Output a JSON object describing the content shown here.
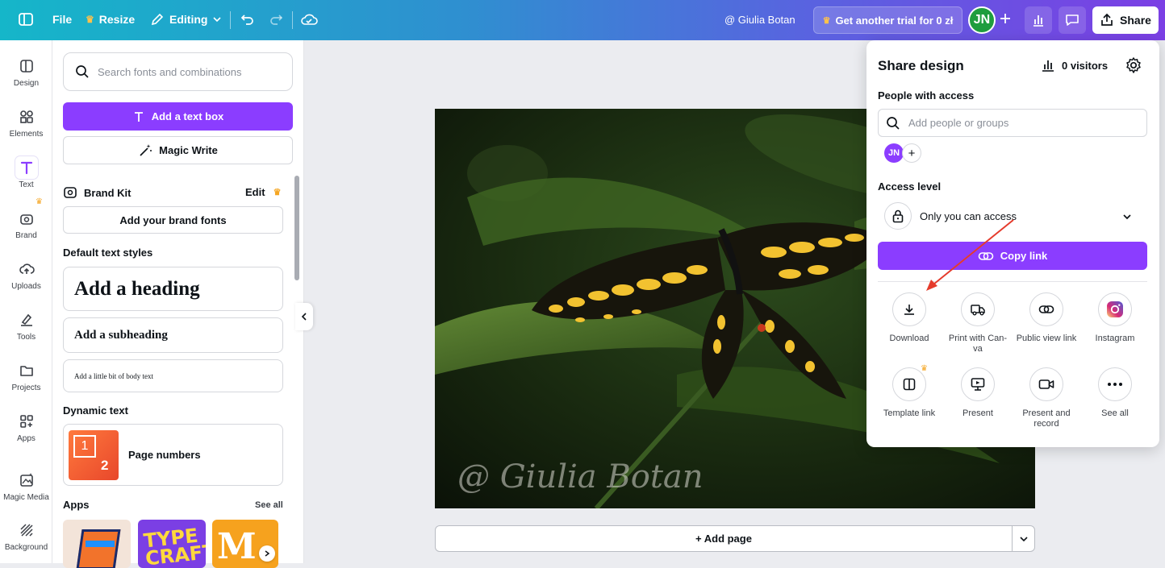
{
  "topbar": {
    "file": "File",
    "resize": "Resize",
    "editing": "Editing",
    "owner": "@ Giulia Botan",
    "trial": "Get another trial for 0 zł",
    "avatar": "JN",
    "share": "Share"
  },
  "rail": {
    "items": [
      "Design",
      "Elements",
      "Text",
      "Brand",
      "Uploads",
      "Tools",
      "Projects",
      "Apps",
      "Magic Media",
      "Background"
    ]
  },
  "panel": {
    "search_placeholder": "Search fonts and combinations",
    "add_text_box": "Add a text box",
    "magic_write": "Magic Write",
    "brand_kit": "Brand Kit",
    "brand_edit": "Edit",
    "add_brand_fonts": "Add your brand fonts",
    "default_styles_title": "Default text styles",
    "heading": "Add a heading",
    "subheading": "Add a subheading",
    "body": "Add a little bit of body text",
    "dynamic_title": "Dynamic text",
    "page_numbers": "Page numbers",
    "apps_title": "Apps",
    "see_all": "See all"
  },
  "canvas": {
    "watermark": "@ Giulia Botan",
    "add_page": "+ Add page"
  },
  "share_popup": {
    "title": "Share design",
    "visitors": "0 visitors",
    "people_label": "People with access",
    "people_placeholder": "Add people or groups",
    "avatar": "JN",
    "access_label": "Access level",
    "access_value": "Only you can access",
    "copy_link": "Copy link",
    "options": [
      {
        "label": "Download",
        "icon": "download-icon"
      },
      {
        "label": "Print with Can-\nva",
        "icon": "truck-icon"
      },
      {
        "label": "Public view link",
        "icon": "link-icon"
      },
      {
        "label": "Instagram",
        "icon": "instagram-icon"
      },
      {
        "label": "Template link",
        "icon": "template-icon"
      },
      {
        "label": "Present",
        "icon": "present-icon"
      },
      {
        "label": "Present and record",
        "icon": "camera-icon"
      },
      {
        "label": "See all",
        "icon": "more-icon"
      }
    ]
  },
  "colors": {
    "accent": "#8b3dff",
    "avatar_green": "#1f9d3e",
    "annotation_arrow": "#e53b2c"
  }
}
